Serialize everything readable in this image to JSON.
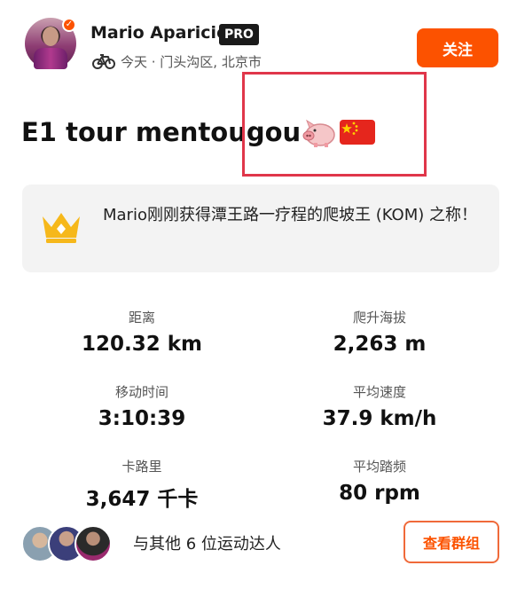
{
  "header": {
    "athlete_name": "Mario Aparicio",
    "badge": "PRO",
    "meta": "今天 · 门头沟区, 北京市",
    "follow_label": "关注",
    "activity_icon": "bike-icon"
  },
  "activity": {
    "title": "E1 tour mentougou",
    "emojis": [
      "pig-icon",
      "china-flag-icon"
    ]
  },
  "achievement": {
    "icon": "crown-icon",
    "text": "Mario刚刚获得潭王路一疗程的爬坡王 (KOM) 之称！"
  },
  "stats": [
    {
      "label": "距离",
      "value": "120.32 km"
    },
    {
      "label": "爬升海拔",
      "value": "2,263 m"
    },
    {
      "label": "移动时间",
      "value": "3:10:39"
    },
    {
      "label": "平均速度",
      "value": "37.9 km/h"
    },
    {
      "label": "卡路里",
      "value": "3,647 千卡"
    },
    {
      "label": "平均踏频",
      "value": "80 rpm"
    }
  ],
  "footer": {
    "others_text": "与其他 6 位运动达人",
    "group_button": "查看群组"
  },
  "colors": {
    "accent": "#fc5200",
    "highlight": "#e0364a",
    "card_bg": "#f3f3f3"
  }
}
